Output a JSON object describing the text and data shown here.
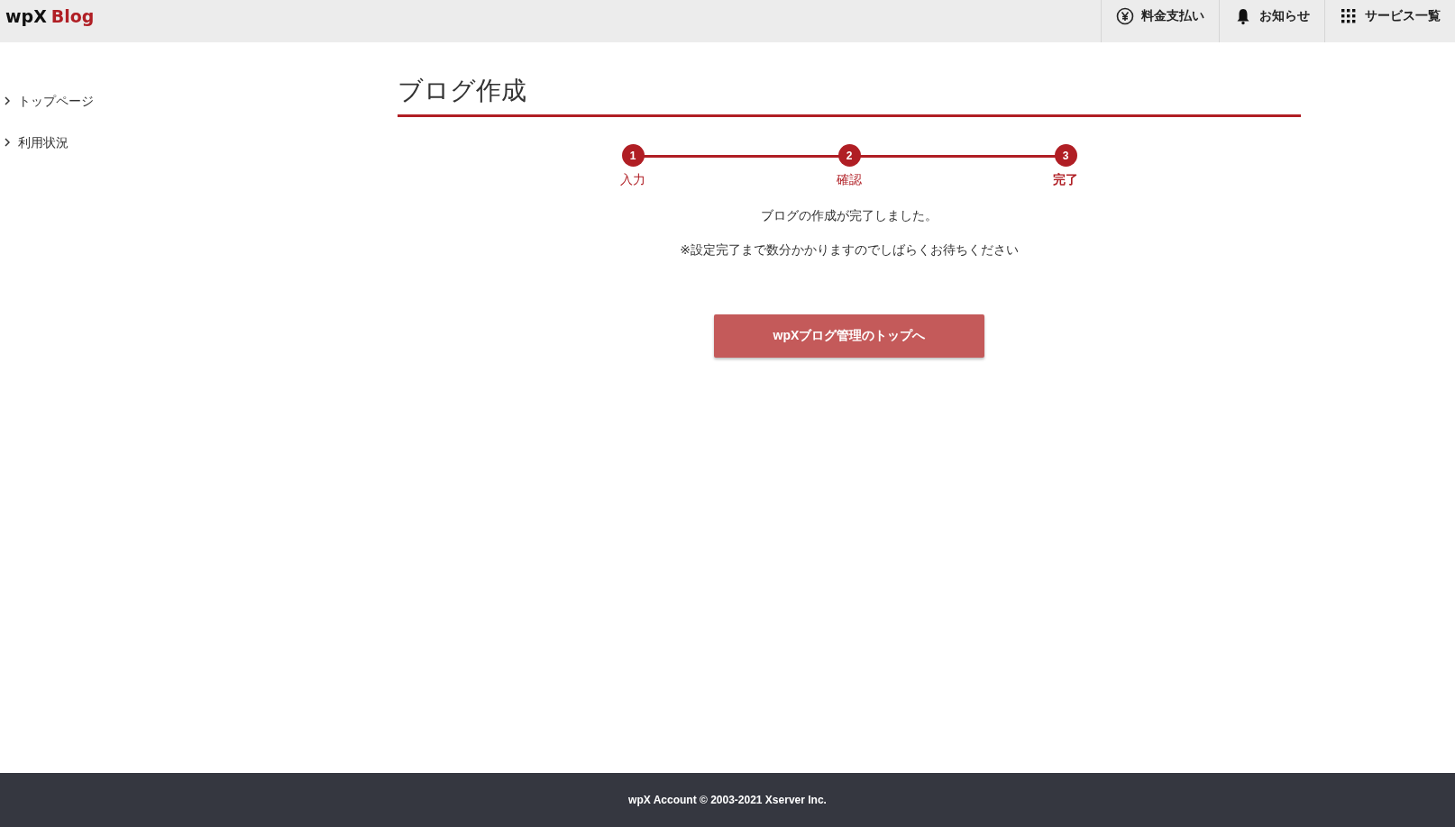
{
  "header": {
    "logo": {
      "part1": "wpX",
      "part2": "Blog"
    },
    "nav": [
      {
        "kind": "yen",
        "label": "料金支払い"
      },
      {
        "kind": "bell",
        "label": "お知らせ"
      },
      {
        "kind": "grid",
        "label": "サービス一覧"
      }
    ]
  },
  "sidebar": {
    "items": [
      {
        "label": "トップページ"
      },
      {
        "label": "利用状況"
      }
    ]
  },
  "page": {
    "title": "ブログ作成",
    "steps": [
      {
        "number": "1",
        "label": "入力",
        "current": false
      },
      {
        "number": "2",
        "label": "確認",
        "current": false
      },
      {
        "number": "3",
        "label": "完了",
        "current": true
      }
    ],
    "message": "ブログの作成が完了しました。",
    "note": "※設定完了まで数分かかりますのでしばらくお待ちください",
    "button": "wpXブログ管理のトップへ"
  },
  "footer": {
    "text": "wpX Account © 2003-2021 Xserver Inc."
  }
}
